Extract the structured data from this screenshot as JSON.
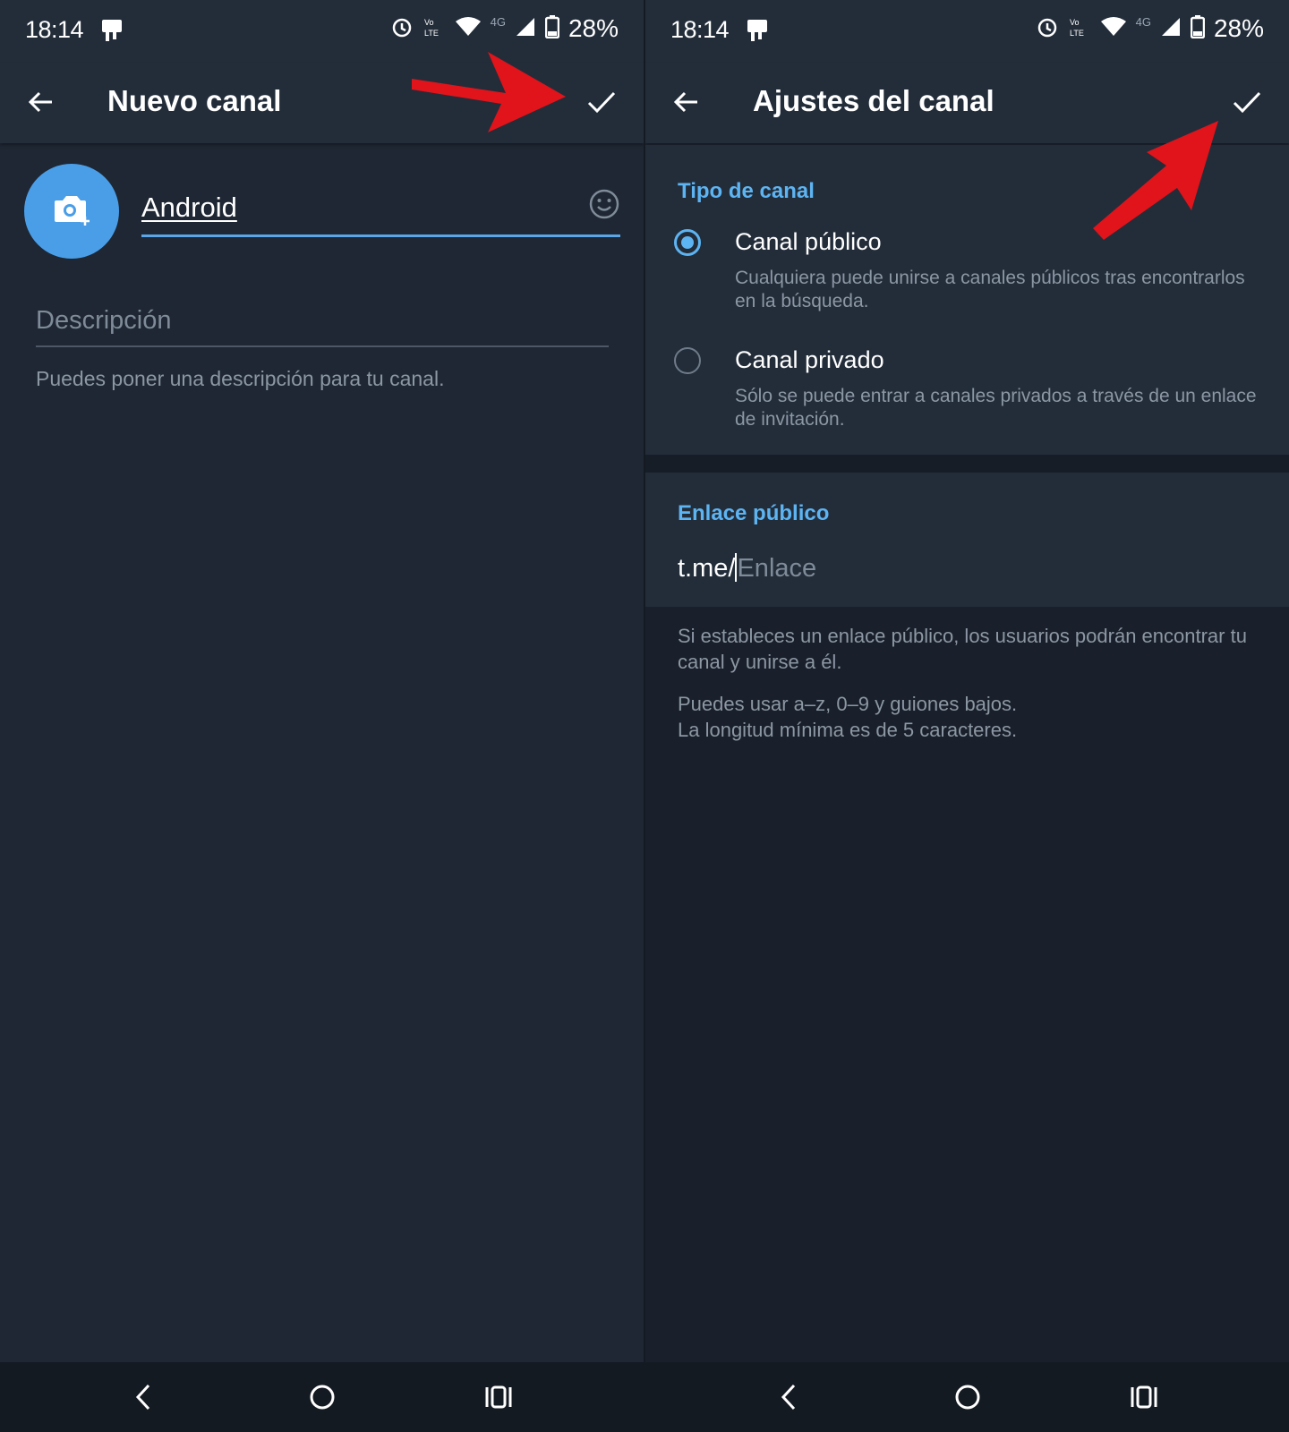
{
  "status_bar": {
    "time": "18:14",
    "battery": "28%",
    "network": "4G"
  },
  "left_screen": {
    "title": "Nuevo canal",
    "name_value": "Android",
    "description_placeholder": "Descripción",
    "description_help": "Puedes poner una descripción para tu canal."
  },
  "right_screen": {
    "title": "Ajustes del canal",
    "channel_type_header": "Tipo de canal",
    "public_label": "Canal público",
    "public_desc": "Cualquiera puede unirse a canales públicos tras encontrarlos en la búsqueda.",
    "private_label": "Canal privado",
    "private_desc": "Sólo se puede entrar a canales privados a través de un enlace de invitación.",
    "selected_type": "Canal público",
    "public_link_header": "Enlace público",
    "link_prefix": "t.me/",
    "link_placeholder": "Enlace",
    "info_1": "Si estableces un enlace público, los usuarios podrán encontrar tu canal y unirse a él.",
    "info_2a": "Puedes usar a–z, 0–9 y guiones bajos.",
    "info_2b": "La longitud mínima es de 5 caracteres."
  },
  "colors": {
    "accent": "#5db4f2",
    "avatar": "#4a9ee8",
    "arrow": "#e0141a",
    "background": "#1e2733"
  },
  "icons": [
    "back-arrow-icon",
    "check-icon",
    "camera-icon",
    "emoji-icon",
    "alarm-icon",
    "volte-icon",
    "wifi-icon",
    "signal-icon",
    "battery-icon",
    "nav-back-icon",
    "nav-home-icon",
    "nav-recents-icon"
  ]
}
